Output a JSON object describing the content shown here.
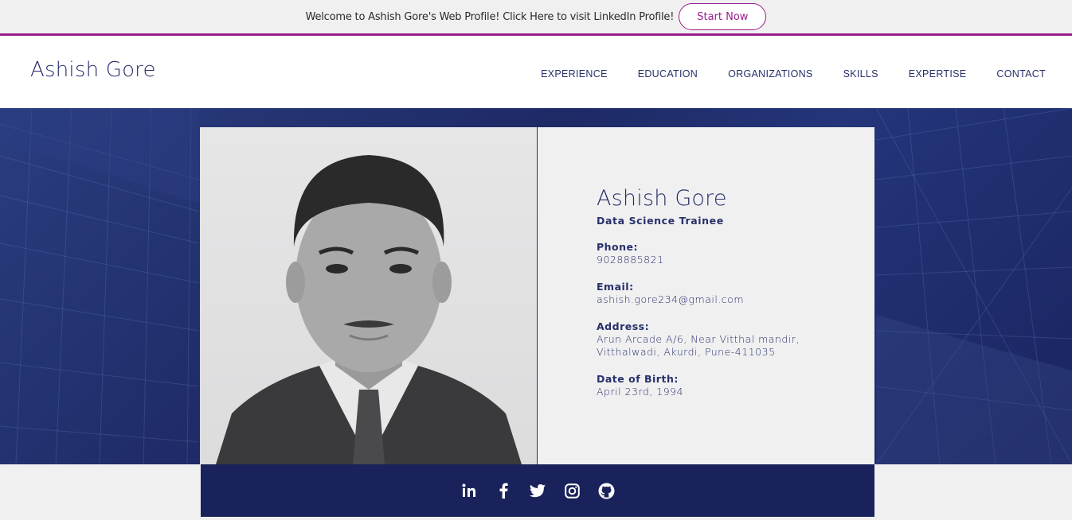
{
  "promo": {
    "text": "Welcome to Ashish Gore's Web Profile! Click Here to visit LinkedIn Profile!",
    "button_label": "Start Now"
  },
  "header": {
    "logo": "Ashish Gore",
    "nav": [
      {
        "label": "EXPERIENCE"
      },
      {
        "label": "EDUCATION"
      },
      {
        "label": "ORGANIZATIONS"
      },
      {
        "label": "SKILLS"
      },
      {
        "label": "EXPERTISE"
      },
      {
        "label": "CONTACT"
      }
    ]
  },
  "profile": {
    "name": "Ashish Gore",
    "title": "Data Science Trainee",
    "phone_label": "Phone:",
    "phone": "9028885821",
    "email_label": "Email:",
    "email": "ashish.gore234@gmail.com",
    "address_label": "Address:",
    "address_line1": "Arun Arcade A/6, Near Vitthal mandir,",
    "address_line2": "Vitthalwadi, Akurdi, Pune-411035",
    "dob_label": "Date of Birth:",
    "dob": "April 23rd, 1994"
  },
  "social": {
    "icons": [
      "linkedin-icon",
      "facebook-icon",
      "twitter-icon",
      "instagram-icon",
      "github-icon"
    ]
  },
  "colors": {
    "accent": "#9b1d8c",
    "navy": "#27306a",
    "footer": "#19225a"
  }
}
